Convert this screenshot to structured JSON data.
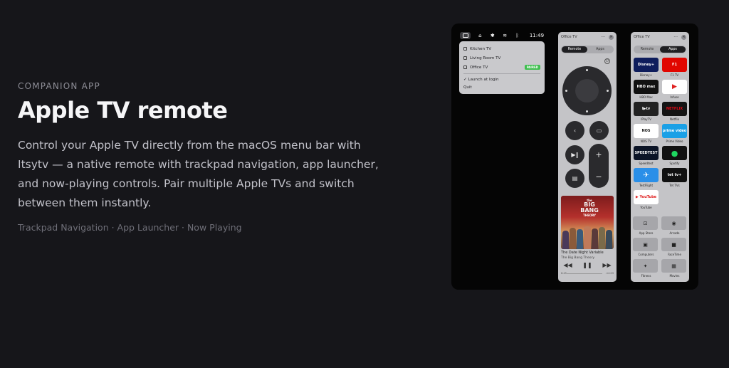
{
  "hero": {
    "eyebrow": "COMPANION APP",
    "title": "Apple TV remote",
    "description": "Control your Apple TV directly from the macOS menu bar with Itsytv — a native remote with trackpad navigation, app launcher, and now-playing controls. Pair multiple Apple TVs and switch between them instantly.",
    "features": "Trackpad Navigation · App Launcher · Now Playing"
  },
  "menubar": {
    "clock": "11:49",
    "icons": [
      "tv-icon",
      "home-icon",
      "control-center-icon",
      "wifi-icon",
      "bluetooth-icon"
    ]
  },
  "dropdown": {
    "devices": [
      {
        "label": "Kitchen TV"
      },
      {
        "label": "Living Room TV"
      },
      {
        "label": "Office TV",
        "badge": "PAIRED"
      }
    ],
    "launch_at_login": "Launch at login",
    "quit": "Quit"
  },
  "remote_panel": {
    "title": "Office TV",
    "tabs": [
      "Remote",
      "Apps"
    ],
    "active_tab": "Remote",
    "now_playing": {
      "show_logo_top": "the",
      "show_logo_main": "BIG BANG",
      "show_logo_bottom": "THEORY",
      "title": "The Date Night Variable",
      "subtitle": "The Big Bang Theory",
      "elapsed": "6:45",
      "remaining": "-14:03"
    }
  },
  "apps_panel": {
    "title": "Office TV",
    "tabs": [
      "Remote",
      "Apps"
    ],
    "active_tab": "Apps",
    "apps": [
      {
        "label": "Disney+",
        "tile_text": "Disney+",
        "color": "#0e1d5c"
      },
      {
        "label": "F1 TV",
        "tile_text": "F1",
        "color": "#e10600"
      },
      {
        "label": "HBO Max",
        "tile_text": "HBO max",
        "color": "#111111"
      },
      {
        "label": "Infuse",
        "tile_text": "▶",
        "color": "#ffffff"
      },
      {
        "label": "IPlayTV",
        "tile_text": "I▶tv",
        "color": "#222222"
      },
      {
        "label": "Netflix",
        "tile_text": "NETFLIX",
        "color": "#141414"
      },
      {
        "label": "NOS TV",
        "tile_text": "NOS",
        "color": "#ffffff"
      },
      {
        "label": "Prime Video",
        "tile_text": "prime video",
        "color": "#1aa0e6"
      },
      {
        "label": "Speedtest",
        "tile_text": "SPEEDTEST",
        "color": "#0b1426"
      },
      {
        "label": "Spotify",
        "tile_text": "●",
        "color": "#111111"
      },
      {
        "label": "TestFlight",
        "tile_text": "✈",
        "color": "#2a8fe8"
      },
      {
        "label": "Tet TVs",
        "tile_text": "tet tv+",
        "color": "#111111"
      },
      {
        "label": "YouTube",
        "tile_text": "▶ YouTube",
        "color": "#ffffff"
      }
    ],
    "system_apps": [
      {
        "label": "App Store",
        "icon": "bag-icon",
        "glyph": "⊡"
      },
      {
        "label": "Arcade",
        "icon": "gamepad-icon",
        "glyph": "◉"
      },
      {
        "label": "Computers",
        "icon": "computers-icon",
        "glyph": "▣"
      },
      {
        "label": "FaceTime",
        "icon": "video-camera-icon",
        "glyph": "■"
      },
      {
        "label": "Fitness",
        "icon": "running-figure-icon",
        "glyph": "✦"
      },
      {
        "label": "Movies",
        "icon": "film-icon",
        "glyph": "▦"
      }
    ]
  }
}
